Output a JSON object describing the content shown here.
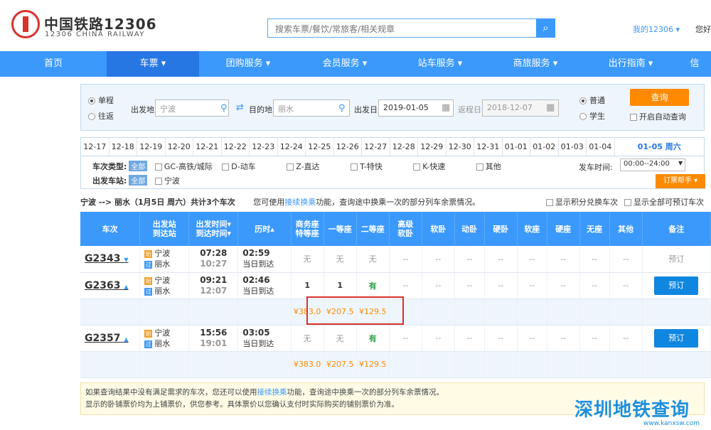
{
  "brand": {
    "title": "中国铁路12306",
    "subtitle": "12306 CHINA RAILWAY"
  },
  "search": {
    "placeholder": "搜索车票/餐饮/常旅客/相关规章",
    "icon": "search-icon"
  },
  "header": {
    "my": "我的12306 ▾",
    "extra": "您好"
  },
  "nav": [
    "首页",
    "车票 ▾",
    "团购服务 ▾",
    "会员服务 ▾",
    "站车服务 ▾",
    "商旅服务 ▾",
    "出行指南 ▾",
    "信"
  ],
  "query": {
    "trip_types": [
      "单程",
      "往返"
    ],
    "from_label": "出发地",
    "from_value": "宁波",
    "to_label": "目的地",
    "to_value": "丽水",
    "date_label": "出发日",
    "date_value": "2019-01-05",
    "return_label": "返程日",
    "return_value": "2018-12-07",
    "ticket_types": [
      "普通",
      "学生"
    ],
    "search_btn": "查询",
    "auto_query": "开启自动查询"
  },
  "dates": [
    "12-17",
    "12-18",
    "12-19",
    "12-20",
    "12-21",
    "12-22",
    "12-23",
    "12-24",
    "12-25",
    "12-26",
    "12-27",
    "12-28",
    "12-29",
    "12-30",
    "12-31",
    "01-01",
    "01-02",
    "01-03",
    "01-04"
  ],
  "selected_date": "01-05 周六",
  "filters": {
    "train_type_label": "车次类型:",
    "all": "全部",
    "types": [
      "GC-高铁/城际",
      "D-动车",
      "Z-直达",
      "T-特快",
      "K-快速",
      "其他"
    ],
    "station_label": "出发车站:",
    "station": "宁波",
    "depart_time_label": "发车时间:",
    "depart_time": "00:00--24:00",
    "helper": "订票帮手 ▾"
  },
  "summary": {
    "route": "宁波 --> 丽水（1月5日 周六）共计3个车次",
    "tip_pre": "您可使用",
    "tip_link": "接续换乘",
    "tip_post": "功能，查询途中换乘一次的部分列车余票情况。",
    "opt1": "显示积分兑换车次",
    "opt2": "显示全部可预订车次"
  },
  "table": {
    "headers": [
      "车次",
      "出发站\n到达站",
      "出发时间▾\n到达时间▾",
      "历时▴",
      "商务座\n特等座",
      "一等座",
      "二等座",
      "高级\n软卧",
      "软卧",
      "动卧",
      "硬卧",
      "软座",
      "硬座",
      "无座",
      "其他",
      "备注"
    ],
    "rows": [
      {
        "no": "G2343",
        "from": "宁波",
        "to": "丽水",
        "dep": "07:28",
        "arr": "10:27",
        "dur": "02:59",
        "arrive": "当日到达",
        "seats": [
          "无",
          "无",
          "无",
          "--",
          "--",
          "--",
          "--",
          "--",
          "--",
          "--",
          "--"
        ],
        "note": "预订"
      },
      {
        "no": "G2363",
        "from": "宁波",
        "to": "丽水",
        "dep": "09:21",
        "arr": "12:07",
        "dur": "02:46",
        "arrive": "当日到达",
        "seats": [
          "1",
          "1",
          "有",
          "--",
          "--",
          "--",
          "--",
          "--",
          "--",
          "--",
          "--"
        ],
        "note": "预订",
        "prices": [
          "¥383.0",
          "¥207.5",
          "¥129.5"
        ]
      },
      {
        "no": "G2357",
        "from": "宁波",
        "to": "丽水",
        "dep": "15:56",
        "arr": "19:01",
        "dur": "03:05",
        "arrive": "当日到达",
        "seats": [
          "无",
          "无",
          "有",
          "--",
          "--",
          "--",
          "--",
          "--",
          "--",
          "--",
          "--"
        ],
        "note": "预订",
        "prices": [
          "¥383.0",
          "¥207.5",
          "¥129.5"
        ]
      }
    ],
    "start_icon": "始",
    "pass_icon": "过"
  },
  "note": {
    "line1_pre": "如果查询结果中没有满足需求的车次，您还可以使用",
    "line1_link": "接续换乘",
    "line1_post": "功能，查询途中换乘一次的部分列车余票情况。",
    "line2": "显示的卧铺票价均为上铺票价，供您参考。具体票价以您确认支付时实际购买的铺别票价为准。"
  },
  "watermark": {
    "text": "深圳地铁查询",
    "url": "www.kanxsw.com"
  },
  "colors": {
    "brand_red": "#d7322c",
    "nav_blue": "#3b99fc",
    "orange": "#ff8a00",
    "green": "#27a145"
  }
}
